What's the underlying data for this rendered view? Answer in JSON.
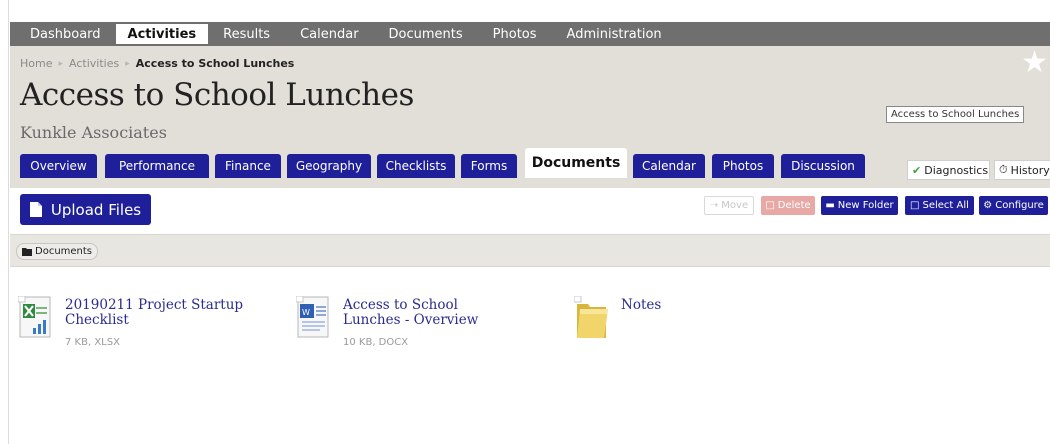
{
  "top_nav": [
    "Dashboard",
    "Activities",
    "Results",
    "Calendar",
    "Documents",
    "Photos",
    "Administration"
  ],
  "top_nav_active": "Activities",
  "breadcrumb": {
    "home": "Home",
    "section": "Activities",
    "current": "Access to School Lunches"
  },
  "page": {
    "title": "Access to School Lunches",
    "organization": "Kunkle Associates",
    "tooltip": "Access to School Lunches"
  },
  "tabs": [
    "Overview",
    "Performance",
    "Finance",
    "Geography",
    "Checklists",
    "Forms",
    "Documents",
    "Calendar",
    "Photos",
    "Discussion"
  ],
  "active_tab": "Documents",
  "side_tabs": {
    "diagnostics": "Diagnostics",
    "history": "History"
  },
  "toolbar": {
    "upload_label": "Upload Files",
    "move_label": "Move",
    "delete_label": "Delete",
    "new_folder_label": "New Folder",
    "select_all_label": "Select All",
    "configure_label": "Configure"
  },
  "folder_crumb": "Documents",
  "files": [
    {
      "name": "20190211 Project Startup Checklist",
      "meta": "7 KB, XLSX",
      "icon": "excel-file-icon"
    },
    {
      "name": "Access to School Lunches - Overview",
      "meta": "10 KB, DOCX",
      "icon": "word-file-icon"
    },
    {
      "name": "Notes",
      "meta": "",
      "icon": "folder-icon"
    }
  ],
  "colors": {
    "accent": "#1f1f9a",
    "nav_bg": "#6f6f6f",
    "header_bg": "#e2dfd9",
    "delete_disabled": "#e7a8a6",
    "link": "#2b2b8f"
  }
}
